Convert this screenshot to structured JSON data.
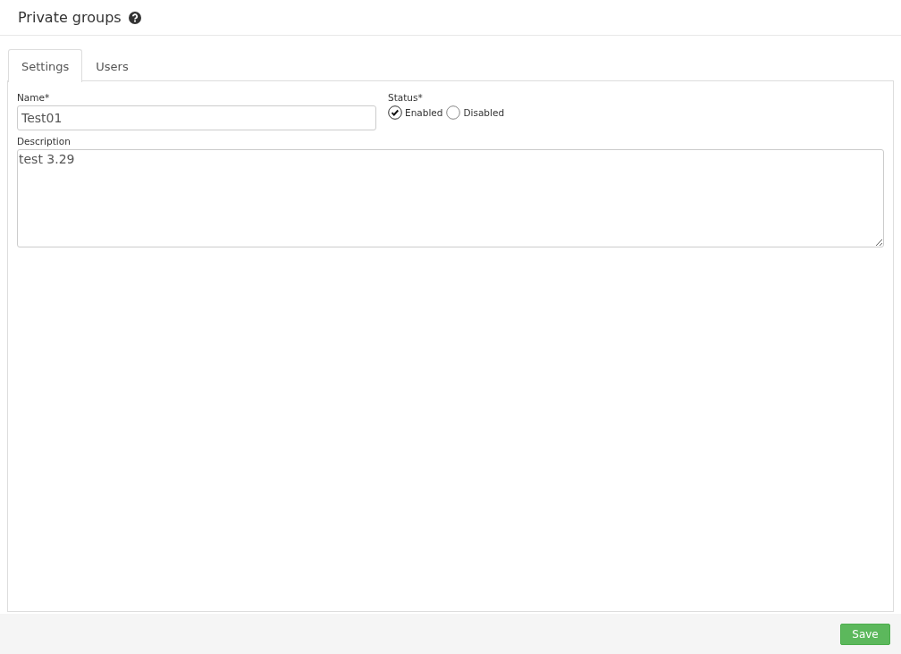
{
  "header": {
    "title": "Private groups"
  },
  "tabs": [
    {
      "label": "Settings",
      "selected": true
    },
    {
      "label": "Users",
      "selected": false
    }
  ],
  "form": {
    "name": {
      "label": "Name*",
      "value": "Test01"
    },
    "status": {
      "label": "Status*",
      "options": [
        {
          "label": "Enabled",
          "selected": true
        },
        {
          "label": "Disabled",
          "selected": false
        }
      ]
    },
    "description": {
      "label": "Description",
      "value": "test 3.29"
    }
  },
  "footer": {
    "buttons": [
      "Save"
    ]
  }
}
